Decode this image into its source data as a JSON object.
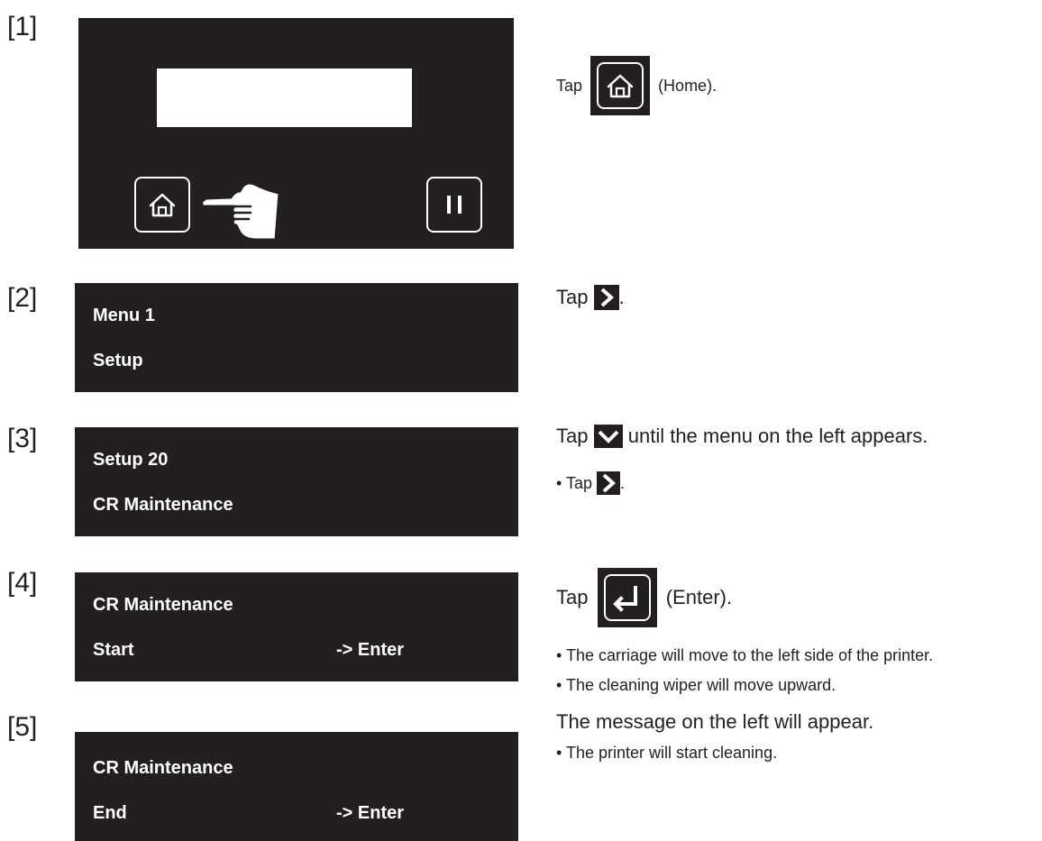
{
  "steps": [
    {
      "num": "[1]"
    },
    {
      "num": "[2]",
      "panel": {
        "line1": "Menu 1",
        "line2": "Setup"
      }
    },
    {
      "num": "[3]",
      "panel": {
        "line1": "Setup 20",
        "line2": "CR Maintenance"
      }
    },
    {
      "num": "[4]",
      "panel": {
        "line1": "CR Maintenance",
        "line2": "Start",
        "enter": "-> Enter"
      }
    },
    {
      "num": "[5]",
      "panel": {
        "line1": "CR Maintenance",
        "line2": "End",
        "enter": "-> Enter"
      }
    }
  ],
  "instructions": {
    "s1_tap": "Tap",
    "s1_home": "(Home).",
    "s2_tap": "Tap",
    "s2_end": ".",
    "s3_tap": "Tap",
    "s3_rest": "until the menu on the left appears.",
    "s3_b1_tap": "• Tap",
    "s3_b1_end": ".",
    "s4_tap": "Tap",
    "s4_enter": "(Enter).",
    "s4_b1": "• The carriage will move to the left side of the printer.",
    "s4_b2": "• The cleaning wiper will move upward.",
    "s5_main": "The message on the left will appear.",
    "s5_b1": "• The printer will start cleaning."
  },
  "icons": {
    "home": "home-icon",
    "pause": "pause-icon",
    "hand": "pointing-hand-icon",
    "right": "chevron-right-icon",
    "down": "chevron-down-icon",
    "enter": "enter-return-icon"
  },
  "colors": {
    "panel": "#231f20",
    "text": "#ffffff",
    "ink": "#231f20"
  }
}
